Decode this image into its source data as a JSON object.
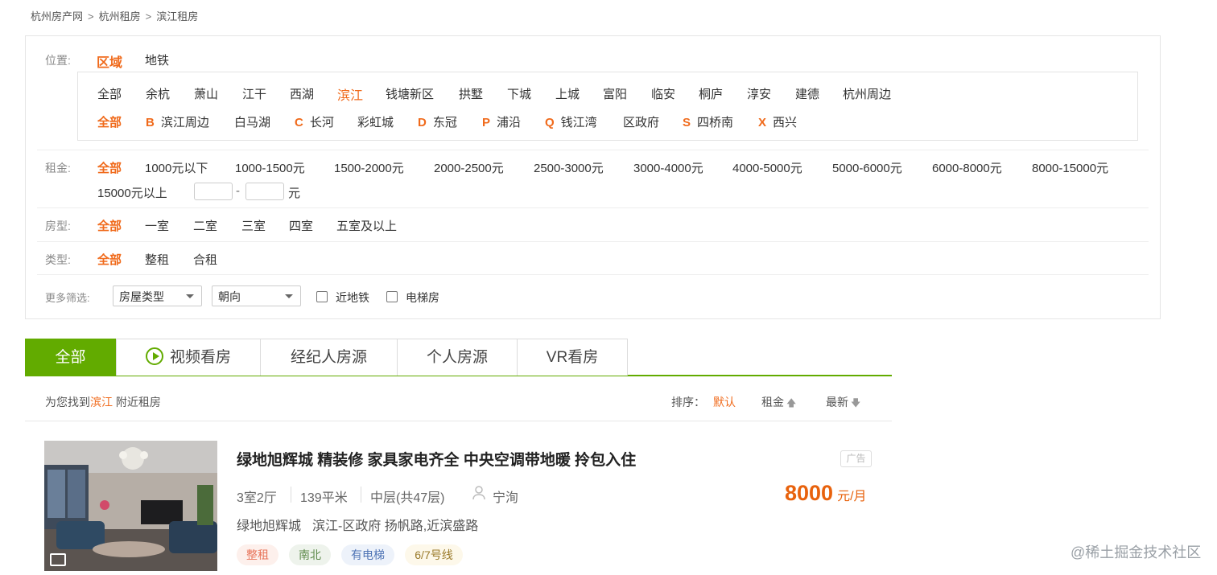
{
  "breadcrumb": {
    "items": [
      "杭州房产网",
      "杭州租房",
      "滨江租房"
    ],
    "separator": ">"
  },
  "filters": {
    "location": {
      "label": "位置:",
      "modes": [
        "区域",
        "地铁"
      ],
      "districts": [
        "全部",
        "余杭",
        "萧山",
        "江干",
        "西湖",
        "滨江",
        "钱塘新区",
        "拱墅",
        "下城",
        "上城",
        "富阳",
        "临安",
        "桐庐",
        "淳安",
        "建德",
        "杭州周边"
      ],
      "areas": {
        "all": "全部",
        "items": [
          {
            "letter": "B",
            "name": "滨江周边"
          },
          {
            "letter": "",
            "name": "白马湖"
          },
          {
            "letter": "C",
            "name": "长河"
          },
          {
            "letter": "",
            "name": "彩虹城"
          },
          {
            "letter": "D",
            "name": "东冠"
          },
          {
            "letter": "P",
            "name": "浦沿"
          },
          {
            "letter": "Q",
            "name": "钱江湾"
          },
          {
            "letter": "",
            "name": "区政府"
          },
          {
            "letter": "S",
            "name": "四桥南"
          },
          {
            "letter": "X",
            "name": "西兴"
          }
        ]
      }
    },
    "rent": {
      "label": "租金:",
      "options": [
        "全部",
        "1000元以下",
        "1000-1500元",
        "1500-2000元",
        "2000-2500元",
        "2500-3000元",
        "3000-4000元",
        "4000-5000元",
        "5000-6000元",
        "6000-8000元",
        "8000-15000元"
      ],
      "last_option": "15000元以上",
      "range_dash": "-",
      "range_unit": "元"
    },
    "room": {
      "label": "房型:",
      "options": [
        "全部",
        "一室",
        "二室",
        "三室",
        "四室",
        "五室及以上"
      ]
    },
    "type": {
      "label": "类型:",
      "options": [
        "全部",
        "整租",
        "合租"
      ]
    },
    "more": {
      "label": "更多筛选:",
      "house_type": "房屋类型",
      "orientation": "朝向",
      "near_subway": "近地铁",
      "elevator": "电梯房"
    }
  },
  "tabs": [
    "全部",
    "视频看房",
    "经纪人房源",
    "个人房源",
    "VR看房"
  ],
  "results": {
    "prefix": "为您找到",
    "area": "滨江",
    "suffix": "附近租房",
    "sort_label": "排序：",
    "sort_default": "默认",
    "sort_rent": "租金",
    "sort_newest": "最新"
  },
  "listing": {
    "title": "绿地旭辉城 精装修 家具家电齐全 中央空调带地暖 拎包入住",
    "ad": "广告",
    "layout": "3室2厅",
    "area": "139平米",
    "floor": "中层(共47层)",
    "agent": "宁洵",
    "address_community": "绿地旭辉城",
    "address_detail": "滨江-区政府 扬帆路,近滨盛路",
    "price": "8000",
    "price_unit": "元/月",
    "tags": [
      "整租",
      "南北",
      "有电梯",
      "6/7号线"
    ]
  },
  "watermark": "@稀土掘金技术社区",
  "colors": {
    "accent": "#f06a1b",
    "tab_green": "#62ab00",
    "price": "#e8620d"
  },
  "icons": [
    "play-icon",
    "person-icon",
    "gallery-icon",
    "arrow-up-icon",
    "arrow-down-icon",
    "chevron-down-icon"
  ]
}
